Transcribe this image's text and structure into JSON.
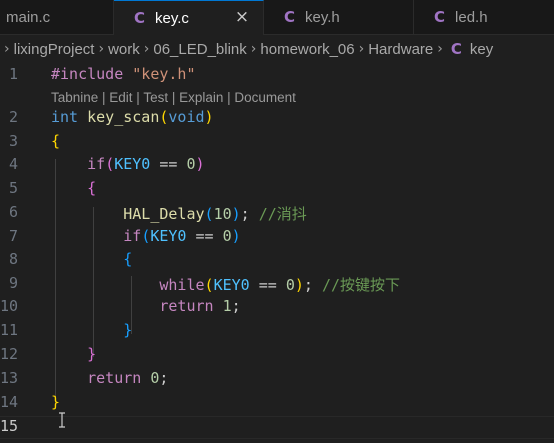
{
  "tabs": [
    {
      "label": "main.c"
    },
    {
      "label": "key.c",
      "icon": "c-file-icon",
      "close": "×"
    },
    {
      "label": "key.h",
      "icon": "c-file-icon"
    },
    {
      "label": "led.h",
      "icon": "c-file-icon"
    }
  ],
  "breadcrumb": [
    "lixingProject",
    "work",
    "06_LED_blink",
    "homework_06",
    "Hardware",
    "key"
  ],
  "breadcrumb_icon": "C",
  "codelens": "Tabnine | Edit | Test | Explain | Document",
  "line_numbers": [
    "1",
    "2",
    "3",
    "4",
    "5",
    "6",
    "7",
    "8",
    "9",
    "10",
    "11",
    "12",
    "13",
    "14",
    "15"
  ],
  "code": {
    "include_kw": "#include",
    "include_str": "\"key.h\"",
    "l2_type": "int",
    "l2_fn": "key_scan",
    "l2_lp": "(",
    "l2_void": "void",
    "l2_rp": ")",
    "l3": "{",
    "l4_if": "if",
    "l4_lp": "(",
    "l4_mac": "KEY0",
    "l4_op": " == ",
    "l4_num": "0",
    "l4_rp": ")",
    "l5": "{",
    "l6_fn": "HAL_Delay",
    "l6_lp": "(",
    "l6_num": "10",
    "l6_rp": ")",
    "l6_semi": "; ",
    "l6_cmt": "//消抖",
    "l7_if": "if",
    "l7_lp": "(",
    "l7_mac": "KEY0",
    "l7_op": " == ",
    "l7_num": "0",
    "l7_rp": ")",
    "l8": "{",
    "l9_while": "while",
    "l9_lp": "(",
    "l9_mac": "KEY0",
    "l9_op": " == ",
    "l9_num": "0",
    "l9_rp": ")",
    "l9_semi": "; ",
    "l9_cmt": "//按键按下",
    "l10_ret": "return",
    "l10_num": "1",
    "l10_semi": ";",
    "l11": "}",
    "l12": "}",
    "l13_ret": "return",
    "l13_num": "0",
    "l13_semi": ";",
    "l14": "}"
  },
  "colors": {
    "background": "#1f1f1f",
    "keyword": "#569cd6",
    "control": "#c586c0",
    "function": "#dcdcaa",
    "string": "#ce9178",
    "number": "#b5cea8",
    "macro": "#4fc1ff",
    "comment": "#6a9955",
    "active_tab_border": "#0078d4"
  }
}
